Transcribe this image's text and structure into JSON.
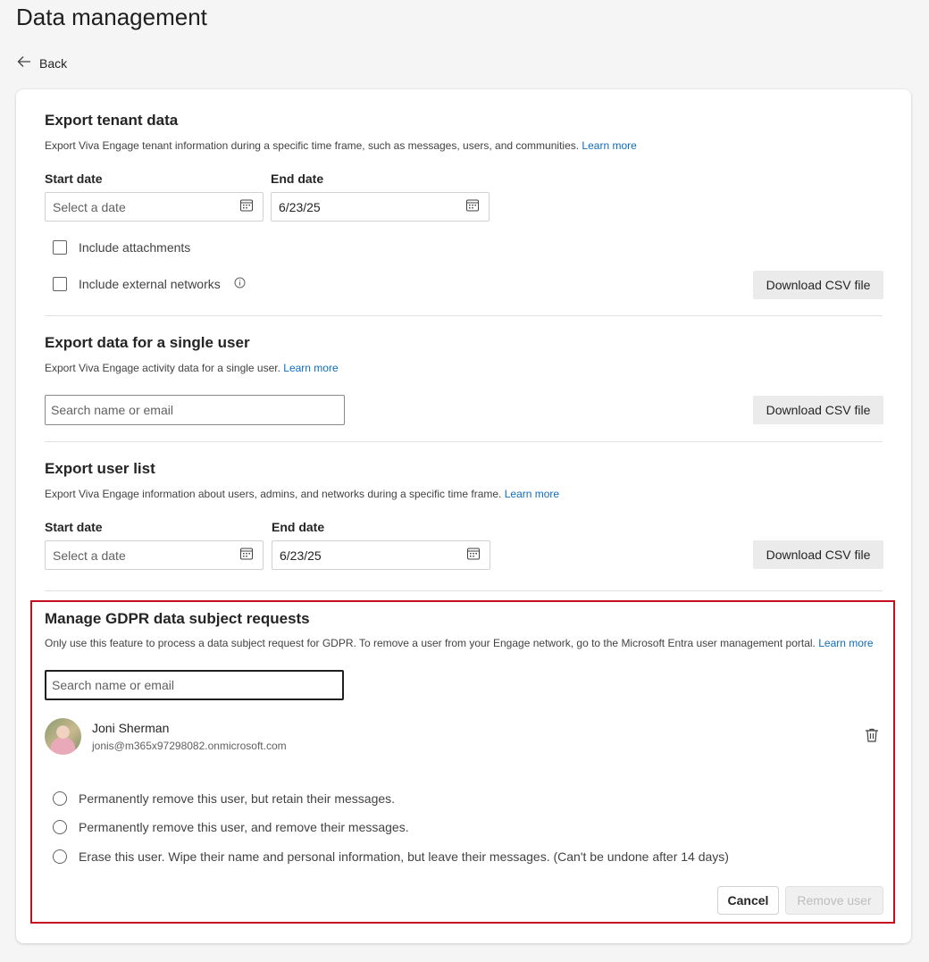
{
  "page": {
    "title": "Data management",
    "back_label": "Back"
  },
  "export_tenant": {
    "title": "Export tenant data",
    "description": "Export Viva Engage tenant information during a specific time frame, such as messages, users, and communities.",
    "learn_more": "Learn more",
    "start_label": "Start date",
    "start_placeholder": "Select a date",
    "end_label": "End date",
    "end_value": "6/23/25",
    "include_attachments": "Include attachments",
    "include_external": "Include external networks",
    "download_label": "Download CSV file"
  },
  "export_single_user": {
    "title": "Export data for a single user",
    "description": "Export Viva Engage activity data for a single user.",
    "learn_more": "Learn more",
    "search_placeholder": "Search name or email",
    "download_label": "Download CSV file"
  },
  "export_user_list": {
    "title": "Export user list",
    "description": "Export Viva Engage information about users, admins, and networks during a specific time frame.",
    "learn_more": "Learn more",
    "start_label": "Start date",
    "start_placeholder": "Select a date",
    "end_label": "End date",
    "end_value": "6/23/25",
    "download_label": "Download CSV file"
  },
  "gdpr": {
    "title": "Manage GDPR data subject requests",
    "description": "Only use this feature to process a data subject request for GDPR. To remove a user from your Engage network, go to the Microsoft Entra user management portal.",
    "learn_more": "Learn more",
    "search_placeholder": "Search name or email",
    "user": {
      "name": "Joni Sherman",
      "email": "jonis@m365x97298082.onmicrosoft.com"
    },
    "options": [
      "Permanently remove this user, but retain their messages.",
      "Permanently remove this user, and remove their messages.",
      "Erase this user. Wipe their name and personal information, but leave their messages. (Can't be undone after 14 days)"
    ],
    "cancel_label": "Cancel",
    "remove_label": "Remove user"
  },
  "colors": {
    "link": "#0f6cbd",
    "highlight": "#c50f1f"
  }
}
